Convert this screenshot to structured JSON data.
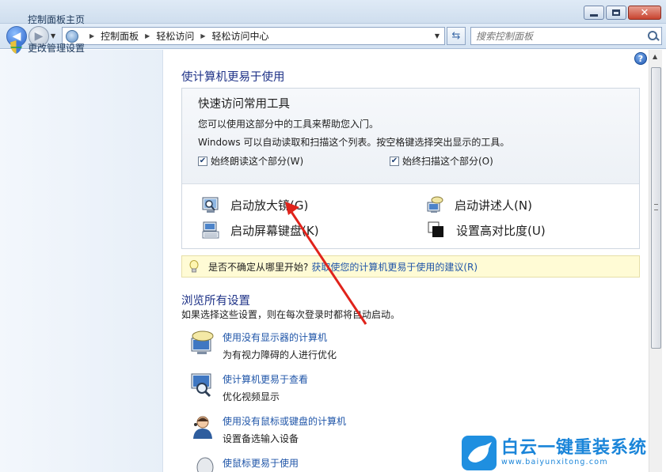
{
  "nav": {
    "breadcrumbs": [
      "控制面板",
      "轻松访问",
      "轻松访问中心"
    ],
    "search_placeholder": "搜索控制面板"
  },
  "sidebar": {
    "items": [
      {
        "label": "控制面板主页"
      },
      {
        "label": "更改管理设置",
        "icon": "shield-icon"
      }
    ]
  },
  "main": {
    "title": "使计算机更易于使用",
    "quick": {
      "title": "快速访问常用工具",
      "desc1": "您可以使用这部分中的工具来帮助您入门。",
      "desc2": "Windows 可以自动读取和扫描这个列表。按空格键选择突出显示的工具。",
      "check_read": {
        "label": "始终朗读这个部分(W)",
        "checked": true
      },
      "check_scan": {
        "label": "始终扫描这个部分(O)",
        "checked": true
      },
      "tools": [
        {
          "label": "启动放大镜(G)",
          "icon": "magnifier-icon"
        },
        {
          "label": "启动讲述人(N)",
          "icon": "narrator-icon"
        },
        {
          "label": "启动屏幕键盘(K)",
          "icon": "keyboard-icon"
        },
        {
          "label": "设置高对比度(U)",
          "icon": "contrast-icon"
        }
      ]
    },
    "tip": {
      "text": "是否不确定从哪里开始?",
      "link": "获取使您的计算机更易于使用的建议(R)"
    },
    "browse": {
      "title": "浏览所有设置",
      "desc": "如果选择这些设置，则在每次登录时都将自动启动。",
      "items": [
        {
          "link": "使用没有显示器的计算机",
          "desc": "为有视力障碍的人进行优化"
        },
        {
          "link": "使计算机更易于查看",
          "desc": "优化视频显示"
        },
        {
          "link": "使用没有鼠标或键盘的计算机",
          "desc": "设置备选输入设备"
        },
        {
          "link": "使鼠标更易于使用",
          "desc": ""
        }
      ]
    }
  },
  "watermark": {
    "main": "白云一键重装系统",
    "sub": "www.baiyunxitong.com"
  },
  "colors": {
    "link": "#1f55a8",
    "heading": "#1e3287",
    "tip_bg": "#fffbd5",
    "annotation": "#e0231b",
    "watermark": "#1a85d9"
  }
}
